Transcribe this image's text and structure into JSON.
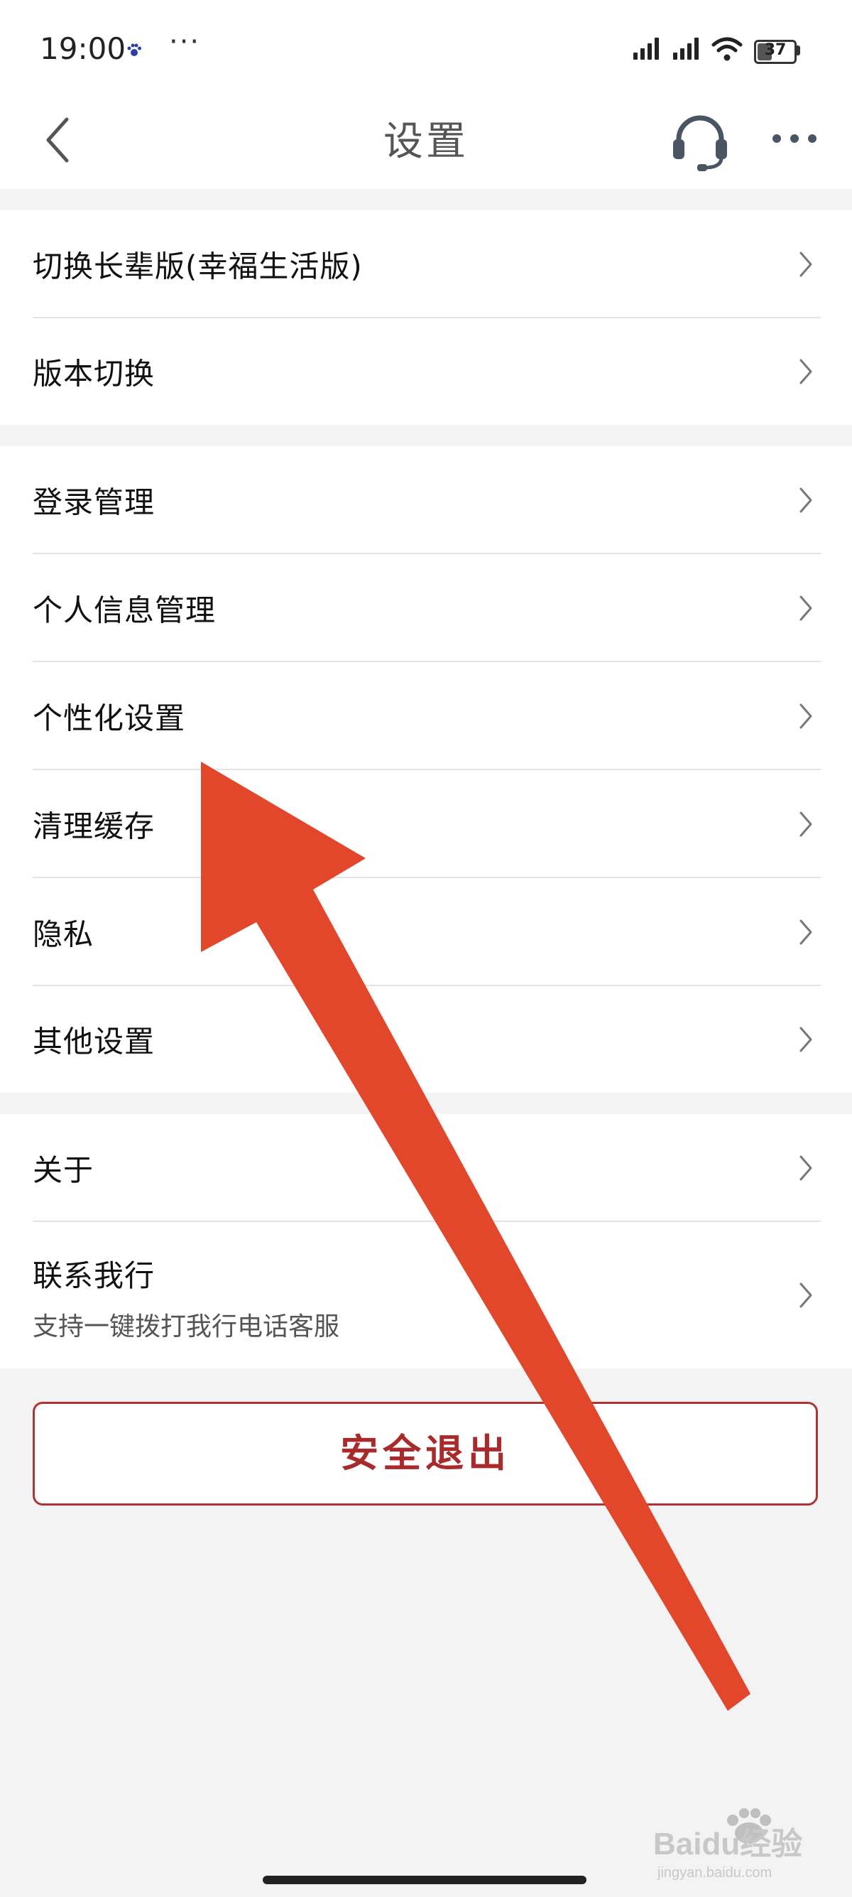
{
  "status_bar": {
    "time": "19:00",
    "dots": "···",
    "battery": "37",
    "battery_level": 0.37
  },
  "nav": {
    "title": "设置",
    "icons": {
      "back": "back-arrow-icon",
      "service": "headset-icon",
      "more": "more-dots-icon"
    }
  },
  "sections": [
    {
      "items": [
        {
          "label": "切换长辈版(幸福生活版)"
        },
        {
          "label": "版本切换"
        }
      ]
    },
    {
      "items": [
        {
          "label": "登录管理"
        },
        {
          "label": "个人信息管理"
        },
        {
          "label": "个性化设置"
        },
        {
          "label": "清理缓存"
        },
        {
          "label": "隐私"
        },
        {
          "label": "其他设置"
        }
      ]
    },
    {
      "items": [
        {
          "label": "关于"
        },
        {
          "label": "联系我行",
          "sublabel": "支持一键拨打我行电话客服"
        }
      ]
    }
  ],
  "logout_label": "安全退出",
  "watermark": {
    "text": "Baidu经验",
    "url": "jingyan.baidu.com"
  },
  "annotation": {
    "arrow_color": "#e2462b"
  }
}
